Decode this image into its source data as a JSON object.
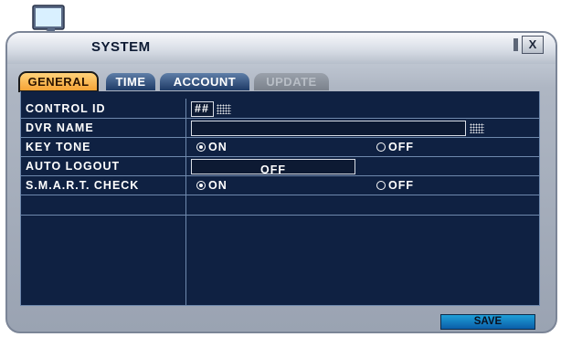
{
  "window": {
    "title": "SYSTEM",
    "close_label": "X"
  },
  "tabs": [
    {
      "label": "GENERAL",
      "state": "active"
    },
    {
      "label": "TIME",
      "state": "normal"
    },
    {
      "label": "ACCOUNT",
      "state": "normal"
    },
    {
      "label": "UPDATE",
      "state": "disabled"
    }
  ],
  "settings": {
    "control_id": {
      "label": "CONTROL ID",
      "value": "##"
    },
    "dvr_name": {
      "label": "DVR NAME",
      "value": ""
    },
    "key_tone": {
      "label": "KEY TONE",
      "on_label": "ON",
      "off_label": "OFF",
      "selected": "ON"
    },
    "auto_logout": {
      "label": "AUTO LOGOUT",
      "value": "OFF"
    },
    "smart_check": {
      "label": "S.M.A.R.T. CHECK",
      "on_label": "ON",
      "off_label": "OFF",
      "selected": "ON"
    }
  },
  "footer": {
    "save_label": "SAVE"
  },
  "colors": {
    "panel_bg": "#0f2142",
    "grid_line": "#6f89ad",
    "tab_active": "#f6a436",
    "save_button": "#1282c4"
  }
}
